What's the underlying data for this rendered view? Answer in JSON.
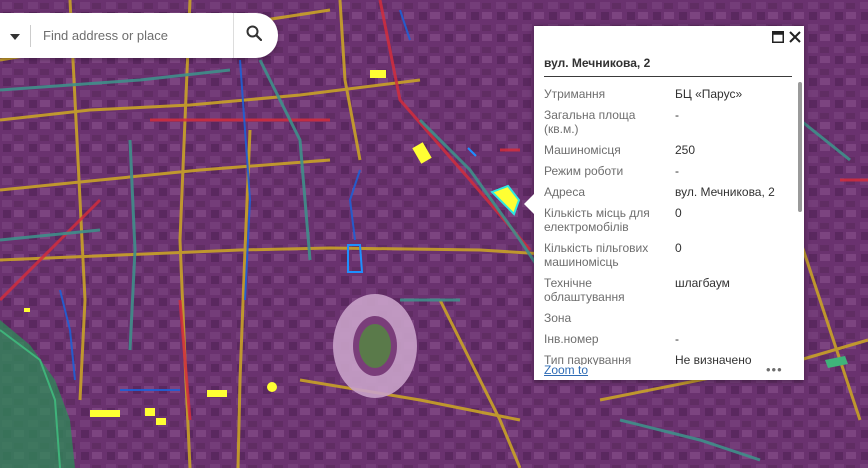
{
  "search": {
    "placeholder": "Find address or place"
  },
  "popup": {
    "title": "вул. Мечникова, 2",
    "rows": [
      {
        "label": "Утримання",
        "value": "БЦ «Парус»"
      },
      {
        "label": "Загальна площа (кв.м.)",
        "value": "-"
      },
      {
        "label": "Машиномісця",
        "value": "250"
      },
      {
        "label": "Режим роботи",
        "value": "-"
      },
      {
        "label": "Адреса",
        "value": "вул. Мечникова, 2"
      },
      {
        "label": "Кількість місць для електромобілів",
        "value": "0"
      },
      {
        "label": "Кількість пільгових машиномісць",
        "value": "0"
      },
      {
        "label": "Технічне облаштування",
        "value": "шлагбаум"
      },
      {
        "label": "Зона",
        "value": ""
      },
      {
        "label": "Інв.номер",
        "value": "-"
      },
      {
        "label": "Тип паркування",
        "value": "Не визначено"
      }
    ],
    "zoom_label": "Zoom to",
    "more_label": "•••"
  },
  "icons": {
    "dropdown": "chevron-down-icon",
    "search": "search-icon",
    "maximize": "maximize-icon",
    "close": "close-icon",
    "more": "more-icon"
  },
  "colors": {
    "overlay": "#6a2a72",
    "road_yellow": "#c9a227",
    "road_red": "#d22d3c",
    "road_teal": "#3f8f8a",
    "road_blue": "#1e5fd6",
    "parking_yellow": "#ffff33",
    "selected_outline": "#2fe6e0",
    "green_zone": "#2e8b57",
    "link": "#2e6cb5"
  }
}
